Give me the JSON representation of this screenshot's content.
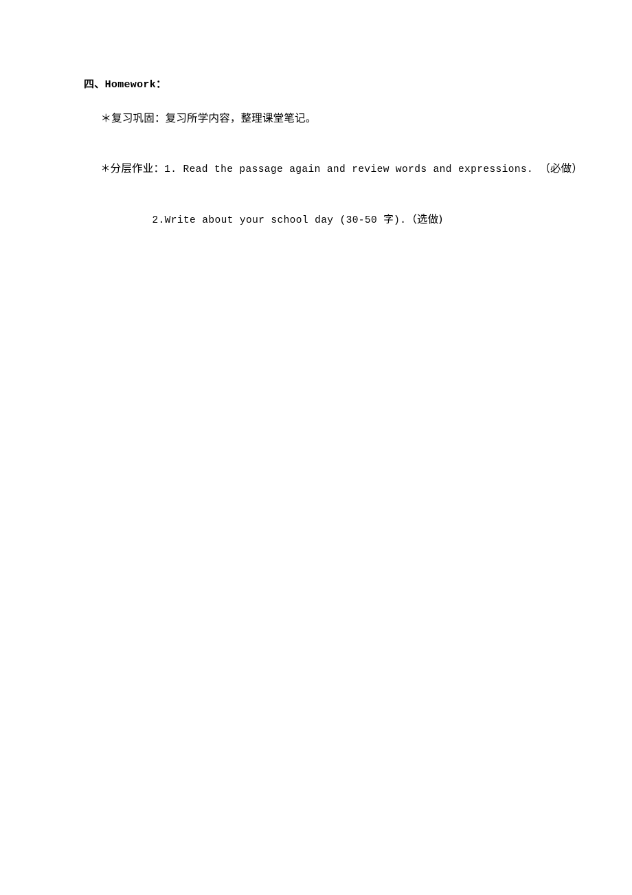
{
  "document": {
    "page_background": "#ffffff",
    "text_color": "#000000",
    "section": {
      "number_label": "四、",
      "heading": "Homework：",
      "heading_full": "四、Homework："
    },
    "items": [
      {
        "bullet": "＊",
        "label": "复习巩固：",
        "text": "复习所学内容，整理课堂笔记。",
        "full": "＊复习巩固：复习所学内容，整理课堂笔记。"
      },
      {
        "bullet": "＊",
        "label": "分层作业：",
        "number": "1.",
        "text": "Read the passage again and review words and expressions.",
        "tag": "（必做）",
        "full": "＊分层作业：1. Read the passage again and review words and expressions. （必做）"
      },
      {
        "number": "2.",
        "text": "Write about your school day (30-50 字).",
        "tag": "（选做)",
        "full": "2.Write about your school day (30-50 字). （选做)"
      }
    ]
  }
}
